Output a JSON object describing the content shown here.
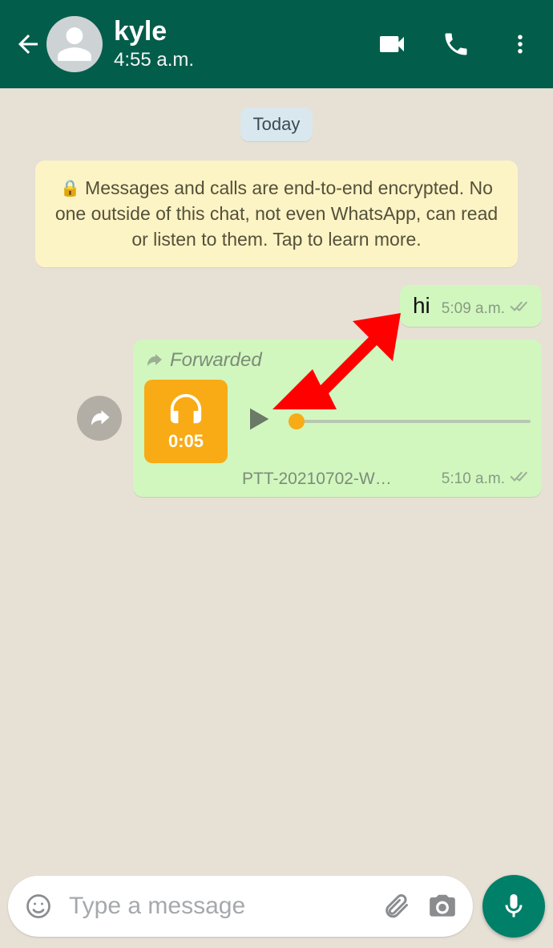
{
  "header": {
    "contact_name": "kyle",
    "subtitle": "4:55 a.m."
  },
  "chat": {
    "date_label": "Today",
    "encryption_notice": "Messages and calls are end-to-end encrypted. No one outside of this chat, not even WhatsApp, can read or listen to them. Tap to learn more."
  },
  "messages": {
    "text_msg": {
      "text": "hi",
      "time": "5:09 a.m."
    },
    "voice_msg": {
      "forwarded_label": "Forwarded",
      "duration": "0:05",
      "filename": "PTT-20210702-W…",
      "time": "5:10 a.m."
    }
  },
  "input": {
    "placeholder": "Type a message"
  }
}
